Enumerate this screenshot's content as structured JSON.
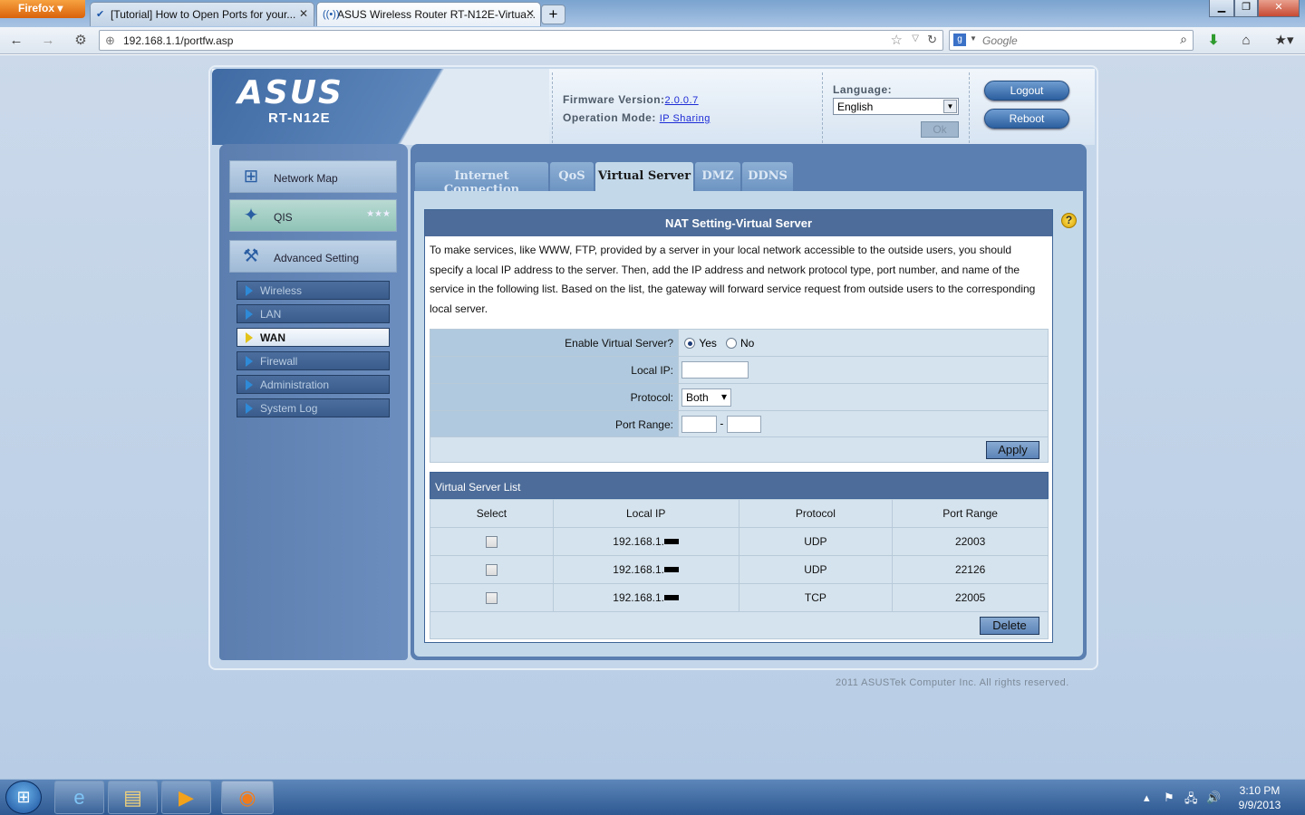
{
  "browser": {
    "app_button": "Firefox",
    "tabs": [
      {
        "title": "[Tutorial] How to Open Ports for your..."
      },
      {
        "title": "ASUS Wireless Router RT-N12E-Virtua..."
      }
    ],
    "new_tab": "+",
    "url": "192.168.1.1/portfw.asp",
    "search_engine_placeholder": "Google"
  },
  "router": {
    "brand": "ASUS",
    "model": "RT-N12E",
    "firmware_label": "Firmware Version:",
    "firmware_value": "2.0.0.7",
    "opmode_label": "Operation Mode:",
    "opmode_value": "IP Sharing",
    "language_label": "Language:",
    "language_value": "English",
    "ok_label": "Ok",
    "logout_label": "Logout",
    "reboot_label": "Reboot"
  },
  "sidebar": {
    "main_items": [
      {
        "label": "Network Map"
      },
      {
        "label": "QIS"
      },
      {
        "label": "Advanced Setting"
      }
    ],
    "sub_items": [
      {
        "label": "Wireless"
      },
      {
        "label": "LAN"
      },
      {
        "label": "WAN"
      },
      {
        "label": "Firewall"
      },
      {
        "label": "Administration"
      },
      {
        "label": "System Log"
      }
    ],
    "selected_sub": "WAN"
  },
  "tabs": [
    {
      "label": "Internet Connection"
    },
    {
      "label": "QoS"
    },
    {
      "label": "Virtual Server"
    },
    {
      "label": "DMZ"
    },
    {
      "label": "DDNS"
    }
  ],
  "panel": {
    "title": "NAT Setting-Virtual Server",
    "help_icon": "?",
    "description": "To make services, like WWW, FTP, provided by a server in your local network accessible to the outside users, you should specify a local IP address to the server. Then, add the IP address and network protocol type, port number, and name of the service in the following list. Based on the list, the gateway will forward service request from outside users to the corresponding local server.",
    "form": {
      "enable_label": "Enable Virtual Server?",
      "yes_label": "Yes",
      "no_label": "No",
      "enabled": "Yes",
      "local_ip_label": "Local IP:",
      "local_ip_value": "",
      "protocol_label": "Protocol:",
      "protocol_value": "Both",
      "port_range_label": "Port Range:",
      "port_range_sep": "-",
      "apply_label": "Apply"
    },
    "list": {
      "title": "Virtual Server List",
      "headers": [
        "Select",
        "Local IP",
        "Protocol",
        "Port Range"
      ],
      "rows": [
        {
          "local_ip": "192.168.1.",
          "protocol": "UDP",
          "port_range": "22003"
        },
        {
          "local_ip": "192.168.1.",
          "protocol": "UDP",
          "port_range": "22126"
        },
        {
          "local_ip": "192.168.1.",
          "protocol": "TCP",
          "port_range": "22005"
        }
      ],
      "delete_label": "Delete"
    }
  },
  "footer": {
    "copyright": "2011 ASUSTek Computer Inc. All rights reserved."
  },
  "taskbar": {
    "time": "3:10 PM",
    "date": "9/9/2013"
  }
}
